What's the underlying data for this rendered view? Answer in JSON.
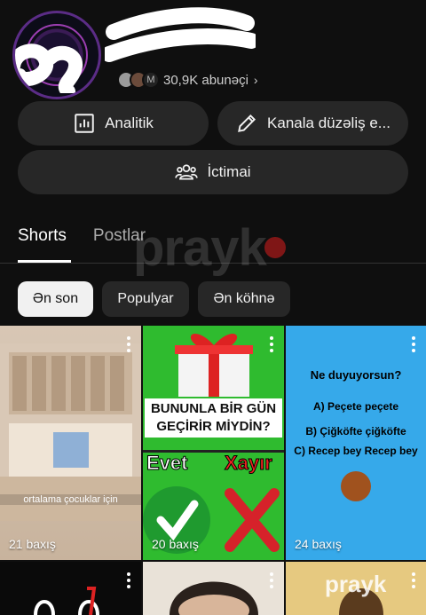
{
  "channel": {
    "subscribers": "30,9K abunəçi",
    "mini_avatar_letter": "M"
  },
  "actions": {
    "analytics_label": "Analitik",
    "edit_label": "Kanala düzəliş e...",
    "community_label": "İctimai"
  },
  "tabs": [
    {
      "label": "Shorts",
      "active": true
    },
    {
      "label": "Postlar",
      "active": false
    }
  ],
  "watermark": "prayk",
  "filters": [
    {
      "label": "Ən son",
      "selected": true
    },
    {
      "label": "Populyar",
      "selected": false
    },
    {
      "label": "Ən köhnə",
      "selected": false
    }
  ],
  "videos": [
    {
      "views": "21 baxış",
      "caption": "ortalama çocuklar için"
    },
    {
      "views": "20 baxış",
      "caption": "BUNUNLA BİR GÜN GEÇİRİR MİYDİN?",
      "left_word": "Evet",
      "right_word": "Xayır"
    },
    {
      "views": "24 baxış",
      "question": "Ne duyuyorsun?",
      "options": [
        "A) Peçete peçete",
        "B) Çiğköfte çiğköfte",
        "C) Recep bey Recep bey"
      ]
    }
  ]
}
